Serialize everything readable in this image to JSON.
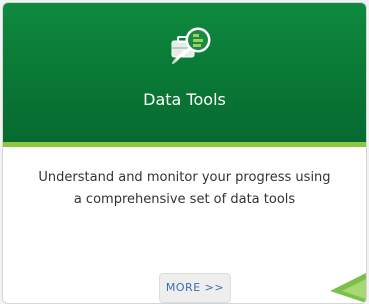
{
  "card": {
    "title": "Data Tools",
    "description": "Understand and monitor your progress using a comprehensive set of data tools",
    "more_label": "MORE >>",
    "icon": "data-tools-icon"
  },
  "colors": {
    "header_green": "#0a7a37",
    "accent_lime": "#8dc63f",
    "link_blue": "#3a6fb0"
  }
}
